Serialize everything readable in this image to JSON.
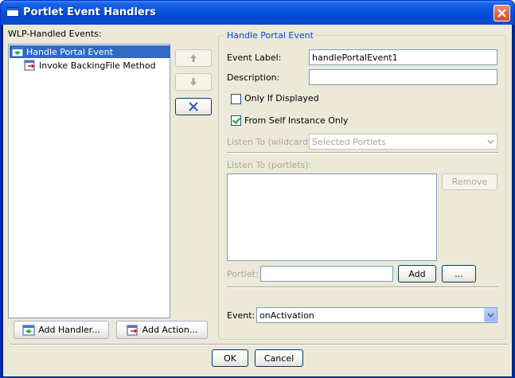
{
  "window": {
    "title": "Portlet Event Handlers"
  },
  "left": {
    "events_label": "WLP-Handled Events:",
    "tree": [
      {
        "label": "Handle Portal Event",
        "selected": true,
        "icon": "portal-event-icon"
      },
      {
        "label": "Invoke BackingFile Method",
        "selected": false,
        "icon": "backing-file-icon"
      }
    ],
    "add_handler": "Add Handler...",
    "add_action": "Add Action..."
  },
  "order_buttons": {
    "up": "up-arrow-icon",
    "down": "down-arrow-icon",
    "delete": "delete-x-icon"
  },
  "panel": {
    "legend": "Handle Portal Event",
    "event_label_label": "Event Label:",
    "event_label_value": "handlePortalEvent1",
    "description_label": "Description:",
    "description_value": "",
    "only_if_displayed": "Only If Displayed",
    "only_if_displayed_checked": false,
    "from_self_instance": "From Self Instance Only",
    "from_self_instance_checked": true,
    "listen_wildcard_label": "Listen To (wildcard):",
    "listen_wildcard_value": "Selected Portlets",
    "listen_portlets_label": "Listen To (portlets):",
    "remove": "Remove",
    "portlet_label": "Portlet:",
    "portlet_value": "",
    "add": "Add",
    "browse": "...",
    "event_label": "Event:",
    "event_value": "onActivation"
  },
  "footer": {
    "ok": "OK",
    "cancel": "Cancel"
  },
  "colors": {
    "selection": "#316ac5",
    "legend": "#0046d5",
    "dialog_bg": "#ece9d8"
  }
}
